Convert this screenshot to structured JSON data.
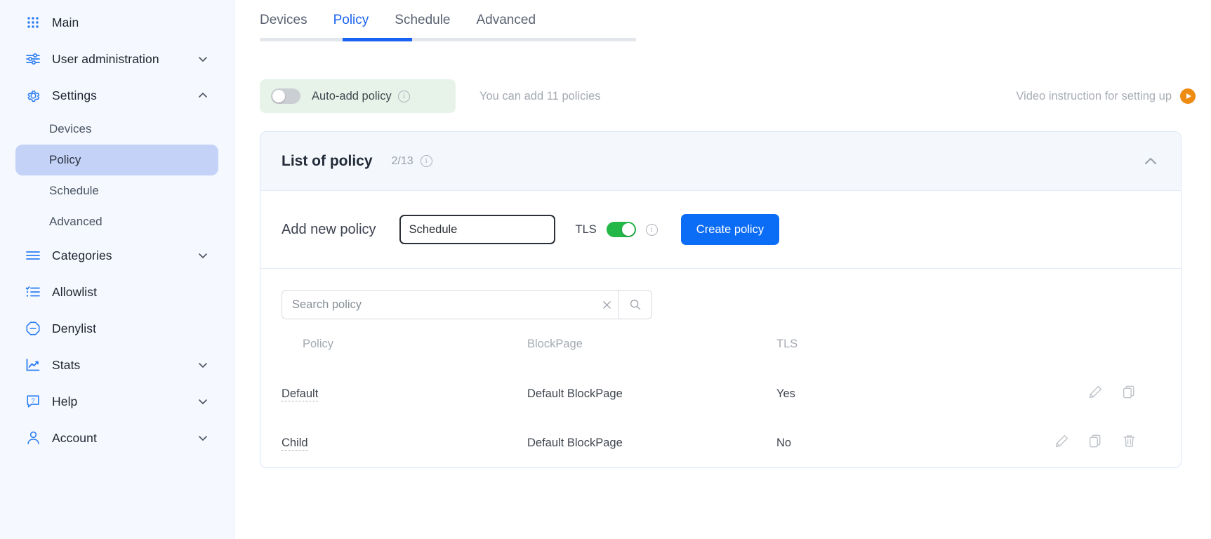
{
  "sidebar": {
    "items": [
      {
        "label": "Main",
        "icon": "grid-dots-icon",
        "chevron": "none",
        "type": "top"
      },
      {
        "label": "User administration",
        "icon": "sliders-icon",
        "chevron": "down",
        "type": "top"
      },
      {
        "label": "Settings",
        "icon": "gear-icon",
        "chevron": "up",
        "type": "top"
      },
      {
        "label": "Devices",
        "type": "sub",
        "active": false
      },
      {
        "label": "Policy",
        "type": "sub",
        "active": true
      },
      {
        "label": "Schedule",
        "type": "sub",
        "active": false
      },
      {
        "label": "Advanced",
        "type": "sub",
        "active": false
      },
      {
        "label": "Categories",
        "icon": "list-icon",
        "chevron": "down",
        "type": "top"
      },
      {
        "label": "Allowlist",
        "icon": "checklist-icon",
        "chevron": "none",
        "type": "top"
      },
      {
        "label": "Denylist",
        "icon": "minus-octagon-icon",
        "chevron": "none",
        "type": "top"
      },
      {
        "label": "Stats",
        "icon": "chart-line-icon",
        "chevron": "down",
        "type": "top"
      },
      {
        "label": "Help",
        "icon": "question-bubble-icon",
        "chevron": "down",
        "type": "top"
      },
      {
        "label": "Account",
        "icon": "user-icon",
        "chevron": "down",
        "type": "top"
      }
    ]
  },
  "tabs": [
    {
      "label": "Devices",
      "active": false
    },
    {
      "label": "Policy",
      "active": true
    },
    {
      "label": "Schedule",
      "active": false
    },
    {
      "label": "Advanced",
      "active": false
    }
  ],
  "toolbar": {
    "auto_add_label": "Auto-add policy",
    "auto_add_enabled": false,
    "quota_text": "You can add 11 policies",
    "video_link_label": "Video instruction for setting up",
    "play_icon": "play-circle-icon",
    "info_icon": "info-icon"
  },
  "card": {
    "title": "List of policy",
    "count": "2/13",
    "info_icon": "info-icon",
    "collapse_icon": "chevron-up-icon",
    "add_row": {
      "label": "Add new policy",
      "input_value": "Schedule",
      "input_placeholder": "Policy name",
      "tls_label": "TLS",
      "tls_enabled": true,
      "info_icon": "info-icon",
      "create_label": "Create policy"
    },
    "search": {
      "placeholder": "Search policy",
      "value": "",
      "clear_icon": "close-icon",
      "search_icon": "search-icon"
    },
    "table": {
      "columns": [
        "Policy",
        "BlockPage",
        "TLS",
        ""
      ],
      "rows": [
        {
          "policy": "Default",
          "blockpage": "Default BlockPage",
          "tls": "Yes",
          "actions": [
            "edit-icon",
            "copy-icon"
          ]
        },
        {
          "policy": "Child",
          "blockpage": "Default BlockPage",
          "tls": "No",
          "actions": [
            "edit-icon",
            "copy-icon",
            "trash-icon"
          ]
        }
      ]
    }
  },
  "colors": {
    "accent_blue": "#0B6CF5",
    "tab_active": "#1A62F2",
    "toggle_on_green": "#23B748",
    "pill_green_bg": "#E7F3E9",
    "sidebar_bg": "#F5F8FE",
    "sidebar_active": "#C4D2F7",
    "play_orange": "#EE8B12"
  }
}
